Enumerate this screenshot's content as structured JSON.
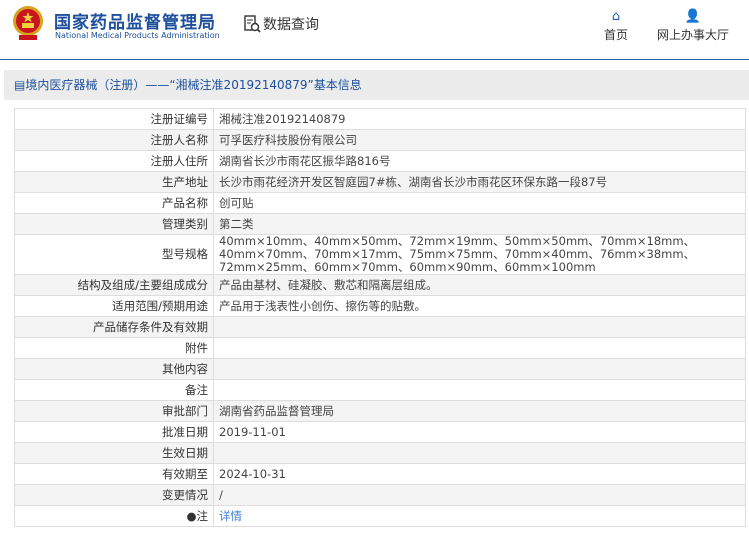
{
  "header": {
    "org_cn": "国家药品监督管理局",
    "org_en": "National Medical Products Administration",
    "query": "数据查询",
    "nav": [
      {
        "label": "首页",
        "icon": "home-icon"
      },
      {
        "label": "网上办事大厅",
        "icon": "user-icon"
      }
    ]
  },
  "breadcrumb": "境内医疗器械（注册）——“湘械注准20192140879”基本信息",
  "rows": [
    {
      "label": "注册证编号",
      "value": "湘械注准20192140879"
    },
    {
      "label": "注册人名称",
      "value": "可孚医疗科技股份有限公司"
    },
    {
      "label": "注册人住所",
      "value": "湖南省长沙市雨花区振华路816号"
    },
    {
      "label": "生产地址",
      "value": "长沙市雨花经济开发区智庭园7#栋、湖南省长沙市雨花区环保东路一段87号"
    },
    {
      "label": "产品名称",
      "value": "创可贴"
    },
    {
      "label": "管理类别",
      "value": "第二类"
    },
    {
      "label": "型号规格",
      "value": "40mm×10mm、40mm×50mm、72mm×19mm、50mm×50mm、70mm×18mm、40mm×70mm、70mm×17mm、75mm×75mm、70mm×40mm、76mm×38mm、72mm×25mm、60mm×70mm、60mm×90mm、60mm×100mm"
    },
    {
      "label": "结构及组成/主要组成成分",
      "value": "产品由基材、硅凝胶、敷芯和隔离层组成。"
    },
    {
      "label": "适用范围/预期用途",
      "value": "产品用于浅表性小创伤、擦伤等的贴敷。"
    },
    {
      "label": "产品储存条件及有效期",
      "value": ""
    },
    {
      "label": "附件",
      "value": ""
    },
    {
      "label": "其他内容",
      "value": ""
    },
    {
      "label": "备注",
      "value": ""
    },
    {
      "label": "审批部门",
      "value": "湖南省药品监督管理局"
    },
    {
      "label": "批准日期",
      "value": "2019-11-01"
    },
    {
      "label": "生效日期",
      "value": ""
    },
    {
      "label": "有效期至",
      "value": "2024-10-31"
    },
    {
      "label": "变更情况",
      "value": "/"
    }
  ],
  "note": {
    "label": "注",
    "link": "详情"
  }
}
